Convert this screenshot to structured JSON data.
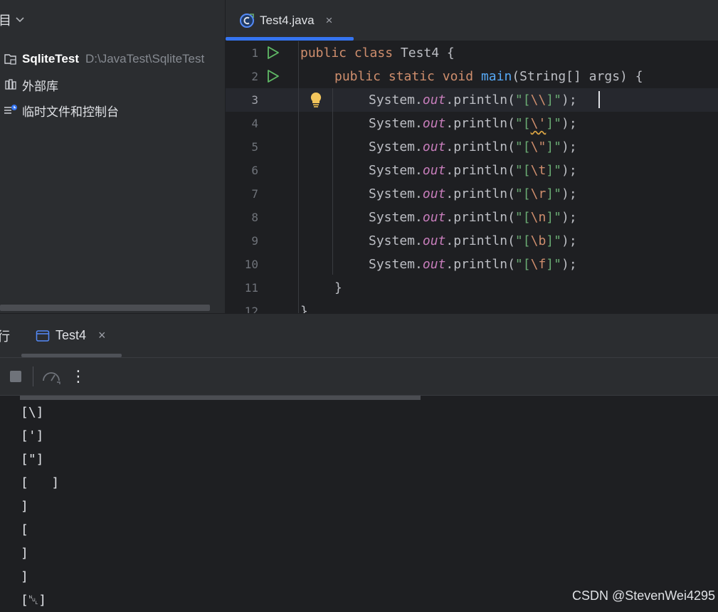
{
  "project_panel": {
    "title": "目",
    "items": [
      {
        "label": "SqliteTest",
        "path": "D:\\JavaTest\\SqliteTest"
      },
      {
        "label": "外部库"
      },
      {
        "label": "临时文件和控制台"
      }
    ]
  },
  "editor": {
    "tab_label": "Test4.java",
    "close_glyph": "×",
    "line_numbers": [
      "1",
      "2",
      "3",
      "4",
      "5",
      "6",
      "7",
      "8",
      "9",
      "10",
      "11",
      "12"
    ],
    "code": {
      "class_decl": {
        "kw1": "public",
        "kw2": "class",
        "name": " Test4 {"
      },
      "main_decl": {
        "kw1": "public",
        "kw2": "static",
        "kw3": "void",
        "fn": "main",
        "rest": "(String[] args) {"
      },
      "prints": [
        {
          "recv": "System.",
          "fld": "out",
          "call": ".println(",
          "pre": "\"[",
          "esc": "\\\\",
          "post": "]\"",
          "end": ");"
        },
        {
          "recv": "System.",
          "fld": "out",
          "call": ".println(",
          "pre": "\"[",
          "esc": "\\'",
          "post": "]\"",
          "end": ");"
        },
        {
          "recv": "System.",
          "fld": "out",
          "call": ".println(",
          "pre": "\"[",
          "esc": "\\\"",
          "post": "]\"",
          "end": ");"
        },
        {
          "recv": "System.",
          "fld": "out",
          "call": ".println(",
          "pre": "\"[",
          "esc": "\\t",
          "post": "]\"",
          "end": ");"
        },
        {
          "recv": "System.",
          "fld": "out",
          "call": ".println(",
          "pre": "\"[",
          "esc": "\\r",
          "post": "]\"",
          "end": ");"
        },
        {
          "recv": "System.",
          "fld": "out",
          "call": ".println(",
          "pre": "\"[",
          "esc": "\\n",
          "post": "]\"",
          "end": ");"
        },
        {
          "recv": "System.",
          "fld": "out",
          "call": ".println(",
          "pre": "\"[",
          "esc": "\\b",
          "post": "]\"",
          "end": ");"
        },
        {
          "recv": "System.",
          "fld": "out",
          "call": ".println(",
          "pre": "\"[",
          "esc": "\\f",
          "post": "]\"",
          "end": ");"
        }
      ],
      "close_main": "}",
      "close_class": "}"
    }
  },
  "run_panel": {
    "title": "行",
    "tab_label": "Test4",
    "close_glyph": "×",
    "more_glyph": "⋮",
    "output": [
      "[\\]",
      "[']",
      "[\"]",
      "[   ]",
      "]",
      "[",
      "]",
      "]",
      "[␀]"
    ]
  },
  "watermark": "CSDN @StevenWei4295",
  "colors": {
    "accent": "#3574f0",
    "run_green": "#5fb865",
    "bulb": "#f2c55c"
  }
}
